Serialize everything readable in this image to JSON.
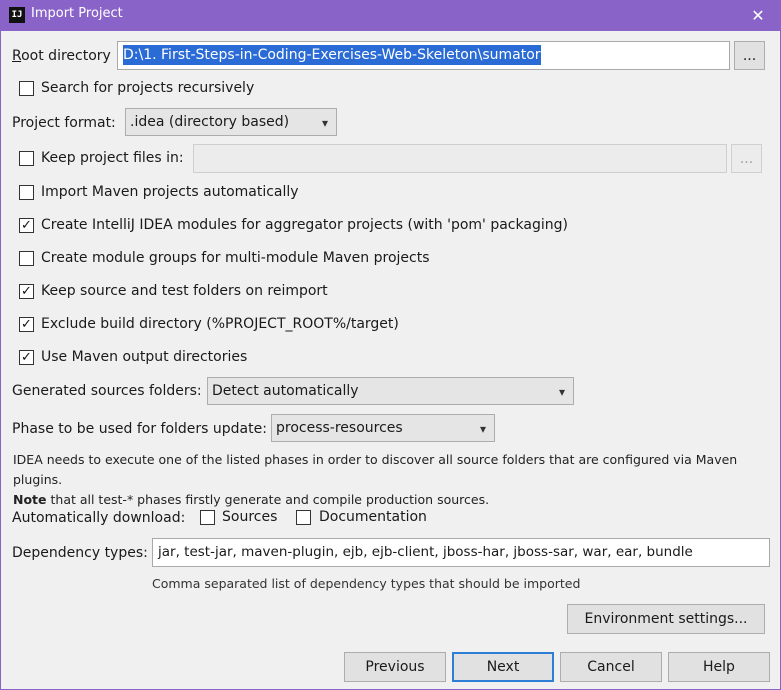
{
  "window": {
    "app_icon": "IJ",
    "title": "Import Project",
    "close_glyph": "✕"
  },
  "root_directory": {
    "label": "Root directory",
    "value": "D:\\1. First-Steps-in-Coding-Exercises-Web-Skeleton\\sumator",
    "browse_label": "..."
  },
  "search_recursively": {
    "label": "Search for projects recursively",
    "checked": false
  },
  "project_format": {
    "label": "Project format:",
    "value": ".idea (directory based)"
  },
  "keep_files": {
    "label": "Keep project files in:",
    "checked": false,
    "value": "",
    "browse_label": "..."
  },
  "options": [
    {
      "label": "Import Maven projects automatically",
      "checked": false
    },
    {
      "label": "Create IntelliJ IDEA modules for aggregator projects (with 'pom' packaging)",
      "checked": true
    },
    {
      "label": "Create module groups for multi-module Maven projects",
      "checked": false
    },
    {
      "label": "Keep source and test folders on reimport",
      "checked": true
    },
    {
      "label": "Exclude build directory (%PROJECT_ROOT%/target)",
      "checked": true
    },
    {
      "label": "Use Maven output directories",
      "checked": true
    }
  ],
  "generated_sources": {
    "label": "Generated sources folders:",
    "value": "Detect automatically"
  },
  "phase": {
    "label": "Phase to be used for folders update:",
    "value": "process-resources"
  },
  "info": {
    "line1": "IDEA needs to execute one of the listed phases in order to discover all source folders that are configured via Maven plugins.",
    "note_bold": "Note",
    "line2_rest": " that all test-* phases firstly generate and compile production sources."
  },
  "auto_download": {
    "label": "Automatically download:",
    "sources": {
      "label": "Sources",
      "checked": false
    },
    "documentation": {
      "label": "Documentation",
      "checked": false
    }
  },
  "dependency_types": {
    "label": "Dependency types:",
    "value": "jar, test-jar, maven-plugin, ejb, ejb-client, jboss-har, jboss-sar, war, ear, bundle",
    "hint": "Comma separated list of dependency types that should be imported"
  },
  "buttons": {
    "environment": "Environment settings...",
    "previous": "Previous",
    "next": "Next",
    "cancel": "Cancel",
    "help": "Help"
  },
  "check_glyph": "✓",
  "chevron_glyph": "▾"
}
